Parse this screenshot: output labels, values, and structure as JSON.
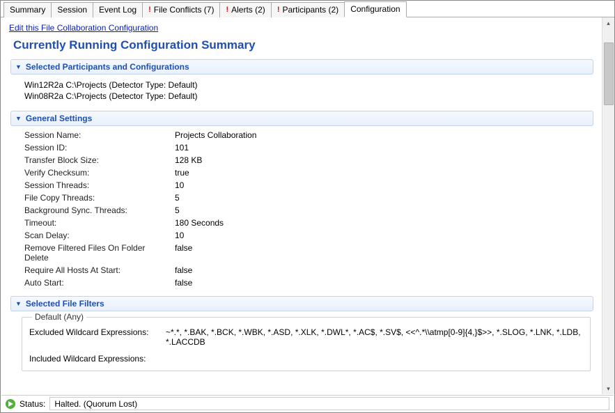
{
  "tabs": [
    {
      "label": "Summary",
      "alert": false
    },
    {
      "label": "Session",
      "alert": false
    },
    {
      "label": "Event Log",
      "alert": false
    },
    {
      "label": "File Conflicts (7)",
      "alert": true
    },
    {
      "label": "Alerts (2)",
      "alert": true
    },
    {
      "label": "Participants (2)",
      "alert": true
    },
    {
      "label": "Configuration",
      "alert": false,
      "active": true
    }
  ],
  "edit_link": "Edit this File Collaboration Configuration",
  "page_title": "Currently Running Configuration Summary",
  "sections": {
    "participants": {
      "title": "Selected Participants and Configurations",
      "lines": [
        "Win12R2a  C:\\Projects (Detector Type: Default)",
        "Win08R2a  C:\\Projects (Detector Type: Default)"
      ]
    },
    "general": {
      "title": "General Settings",
      "rows": [
        {
          "k": "Session Name:",
          "v": "Projects Collaboration"
        },
        {
          "k": "Session ID:",
          "v": "101"
        },
        {
          "k": "Transfer Block Size:",
          "v": "128 KB"
        },
        {
          "k": "Verify Checksum:",
          "v": "true"
        },
        {
          "k": "Session Threads:",
          "v": "10"
        },
        {
          "k": "File Copy Threads:",
          "v": "5"
        },
        {
          "k": "Background Sync. Threads:",
          "v": "5"
        },
        {
          "k": "Timeout:",
          "v": "180 Seconds"
        },
        {
          "k": "Scan Delay:",
          "v": "10"
        },
        {
          "k": "Remove Filtered Files On Folder Delete",
          "v": "false"
        },
        {
          "k": "Require All Hosts At Start:",
          "v": "false"
        },
        {
          "k": "Auto Start:",
          "v": "false"
        }
      ]
    },
    "filters": {
      "title": "Selected File Filters",
      "legend": "Default (Any)",
      "excluded_label": "Excluded Wildcard Expressions:",
      "excluded_value": "~*.*, *.BAK, *.BCK, *.WBK, *.ASD, *.XLK, *.DWL*, *.AC$, *.SV$, <<^.*\\\\atmp[0-9]{4,}$>>, *.SLOG, *.LNK, *.LDB, *.LACCDB",
      "included_label": "Included Wildcard Expressions:",
      "included_value": ""
    }
  },
  "status": {
    "label": "Status:",
    "value": "Halted. (Quorum Lost)"
  }
}
